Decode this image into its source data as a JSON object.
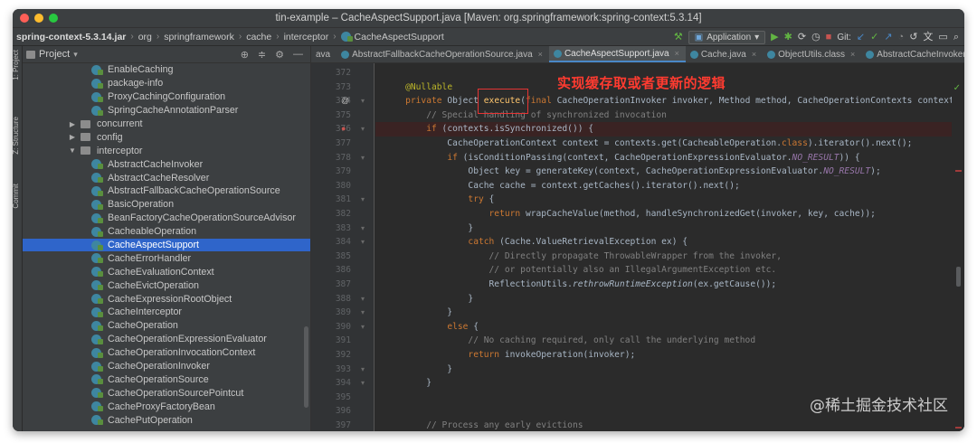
{
  "window": {
    "title": "tin-example – CacheAspectSupport.java [Maven: org.springframework:spring-context:5.3.14]",
    "traffic_colors": [
      "#fe5f57",
      "#febc2e",
      "#28c840"
    ]
  },
  "breadcrumb": [
    "spring-context-5.3.14.jar",
    "org",
    "springframework",
    "cache",
    "interceptor",
    "CacheAspectSupport"
  ],
  "toolbar": {
    "run_config": "Application",
    "git_label": "Git:"
  },
  "stripe": {
    "project": "1: Project",
    "structure": "Z: Structure",
    "commit": "Commit"
  },
  "project_panel": {
    "title": "Project",
    "items": [
      {
        "label": "EnableCaching",
        "kind": "class",
        "indent": 3
      },
      {
        "label": "package-info",
        "kind": "class",
        "indent": 3
      },
      {
        "label": "ProxyCachingConfiguration",
        "kind": "class",
        "indent": 3
      },
      {
        "label": "SpringCacheAnnotationParser",
        "kind": "class",
        "indent": 3
      },
      {
        "label": "concurrent",
        "kind": "package",
        "indent": 2,
        "arrow": "▶"
      },
      {
        "label": "config",
        "kind": "package",
        "indent": 2,
        "arrow": "▶"
      },
      {
        "label": "interceptor",
        "kind": "package",
        "indent": 2,
        "arrow": "▼"
      },
      {
        "label": "AbstractCacheInvoker",
        "kind": "class",
        "indent": 3
      },
      {
        "label": "AbstractCacheResolver",
        "kind": "class",
        "indent": 3
      },
      {
        "label": "AbstractFallbackCacheOperationSource",
        "kind": "class",
        "indent": 3
      },
      {
        "label": "BasicOperation",
        "kind": "class",
        "indent": 3
      },
      {
        "label": "BeanFactoryCacheOperationSourceAdvisor",
        "kind": "class",
        "indent": 3
      },
      {
        "label": "CacheableOperation",
        "kind": "class",
        "indent": 3
      },
      {
        "label": "CacheAspectSupport",
        "kind": "class",
        "indent": 3,
        "selected": true
      },
      {
        "label": "CacheErrorHandler",
        "kind": "class",
        "indent": 3
      },
      {
        "label": "CacheEvaluationContext",
        "kind": "class",
        "indent": 3
      },
      {
        "label": "CacheEvictOperation",
        "kind": "class",
        "indent": 3
      },
      {
        "label": "CacheExpressionRootObject",
        "kind": "class",
        "indent": 3
      },
      {
        "label": "CacheInterceptor",
        "kind": "class",
        "indent": 3
      },
      {
        "label": "CacheOperation",
        "kind": "class",
        "indent": 3
      },
      {
        "label": "CacheOperationExpressionEvaluator",
        "kind": "class",
        "indent": 3
      },
      {
        "label": "CacheOperationInvocationContext",
        "kind": "class",
        "indent": 3
      },
      {
        "label": "CacheOperationInvoker",
        "kind": "class",
        "indent": 3
      },
      {
        "label": "CacheOperationSource",
        "kind": "class",
        "indent": 3
      },
      {
        "label": "CacheOperationSourcePointcut",
        "kind": "class",
        "indent": 3
      },
      {
        "label": "CacheProxyFactoryBean",
        "kind": "class",
        "indent": 3
      },
      {
        "label": "CachePutOperation",
        "kind": "class",
        "indent": 3
      }
    ]
  },
  "tabs": [
    {
      "label": "ava"
    },
    {
      "label": "AbstractFallbackCacheOperationSource.java"
    },
    {
      "label": "CacheAspectSupport.java",
      "active": true
    },
    {
      "label": "Cache.java"
    },
    {
      "label": "ObjectUtils.class"
    },
    {
      "label": "AbstractCacheInvoker.java"
    }
  ],
  "code": {
    "line_numbers": [
      "372",
      "373",
      "374",
      "375",
      "376",
      "377",
      "378",
      "379",
      "380",
      "381",
      "382",
      "383",
      "384",
      "385",
      "386",
      "387",
      "388",
      "389",
      "390",
      "391",
      "392",
      "393",
      "394",
      "395",
      "396",
      "397"
    ],
    "lines": [
      "",
      "    @Nullable",
      "    private Object execute(final CacheOperationInvoker invoker, Method method, CacheOperationContexts contexts) {",
      "        // Special handling of synchronized invocation",
      "        if (contexts.isSynchronized()) {",
      "            CacheOperationContext context = contexts.get(CacheableOperation.class).iterator().next();",
      "            if (isConditionPassing(context, CacheOperationExpressionEvaluator.NO_RESULT)) {",
      "                Object key = generateKey(context, CacheOperationExpressionEvaluator.NO_RESULT);",
      "                Cache cache = context.getCaches().iterator().next();",
      "                try {",
      "                    return wrapCacheValue(method, handleSynchronizedGet(invoker, key, cache));",
      "                }",
      "                catch (Cache.ValueRetrievalException ex) {",
      "                    // Directly propagate ThrowableWrapper from the invoker,",
      "                    // or potentially also an IllegalArgumentException etc.",
      "                    ReflectionUtils.rethrowRuntimeException(ex.getCause());",
      "                }",
      "            }",
      "            else {",
      "                // No caching required, only call the underlying method",
      "                return invokeOperation(invoker);",
      "            }",
      "        }",
      "",
      "",
      "        // Process any early evictions"
    ]
  },
  "annotation": {
    "note": "实现缓存取或者更新的逻辑",
    "color": "#ff3b30"
  },
  "watermark": "@稀土掘金技术社区"
}
